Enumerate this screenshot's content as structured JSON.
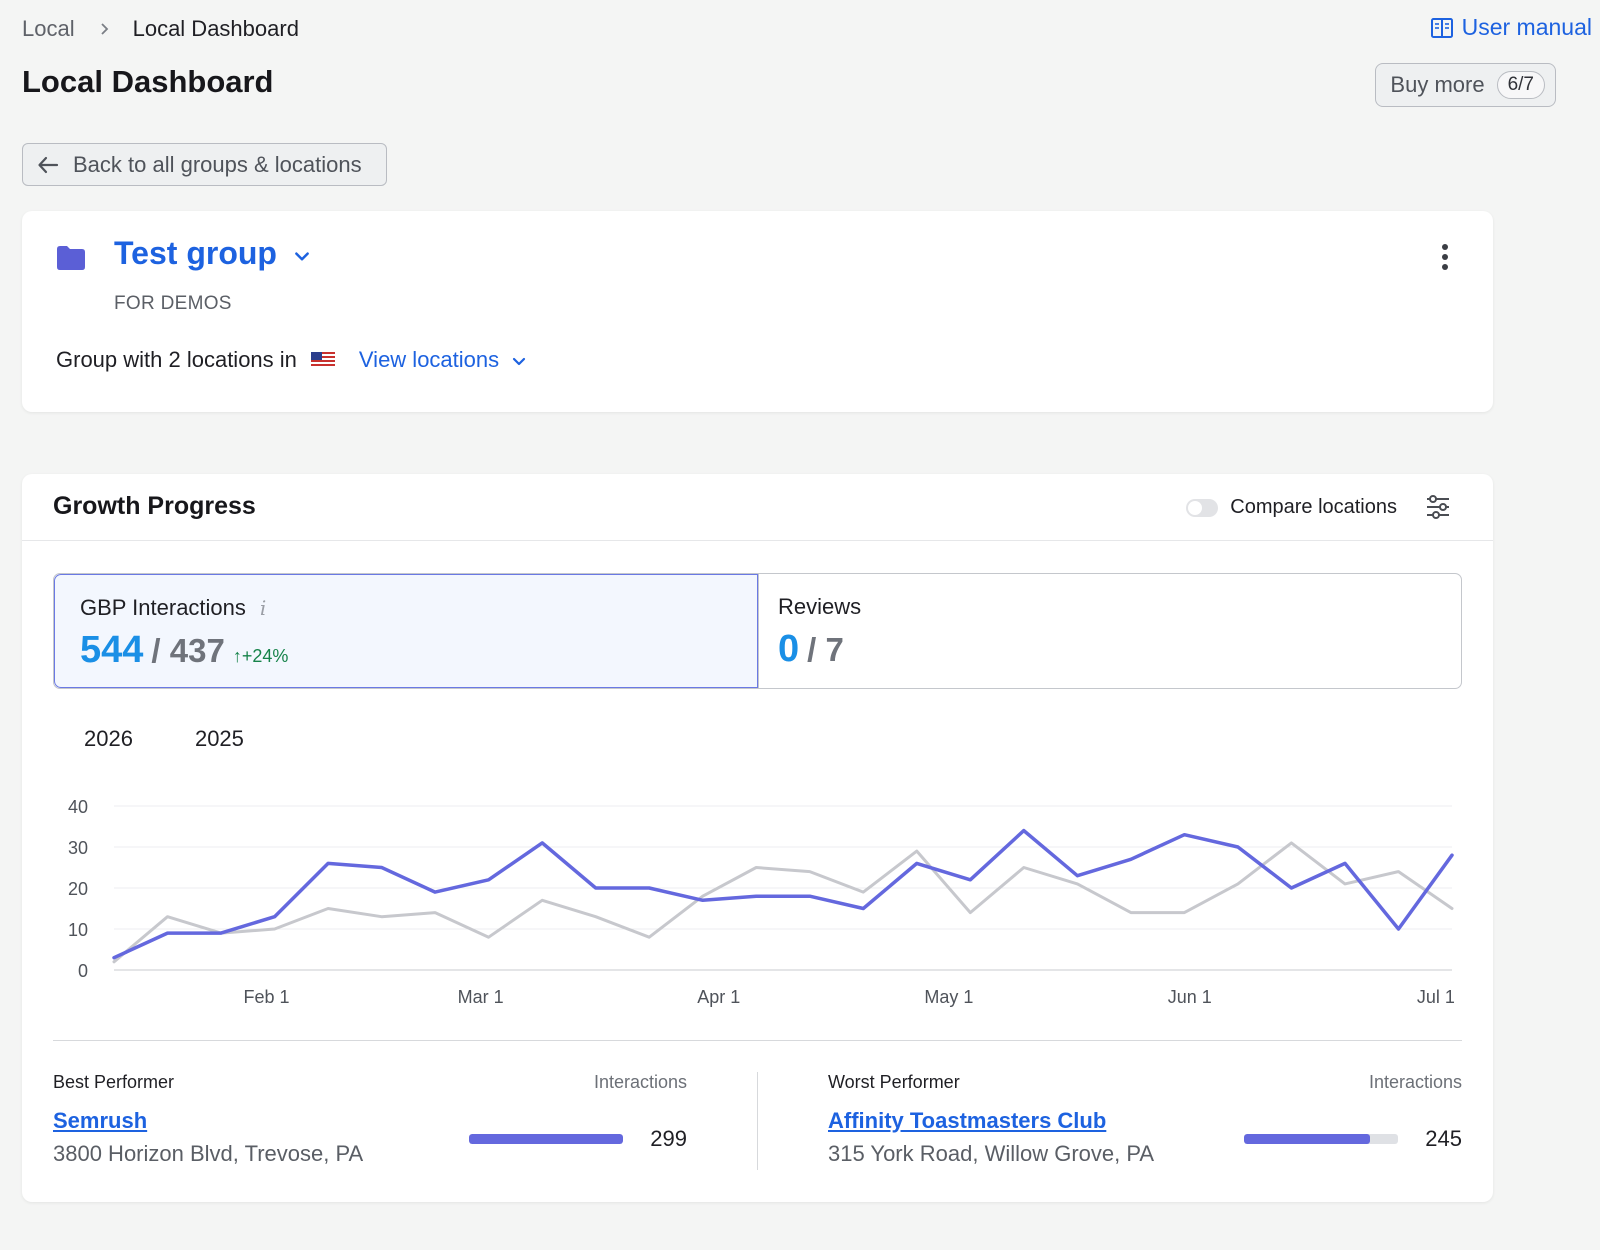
{
  "breadcrumb": {
    "parent": "Local",
    "current": "Local Dashboard"
  },
  "header": {
    "user_manual": "User manual",
    "title": "Local Dashboard",
    "buy_more": "Buy more",
    "buy_more_count": "6/7",
    "back": "Back to all groups & locations"
  },
  "group": {
    "name": "Test group",
    "subtitle": "FOR DEMOS",
    "description": "Group with 2 locations in",
    "view_locations": "View locations"
  },
  "growth": {
    "title": "Growth Progress",
    "compare_label": "Compare locations",
    "compare_on": false,
    "metrics": [
      {
        "label": "GBP Interactions",
        "current": "544",
        "previous": "/ 437",
        "delta": "↑+24%"
      },
      {
        "label": "Reviews",
        "current": "0",
        "previous": "/ 7"
      }
    ],
    "legend": [
      "2026",
      "2025"
    ]
  },
  "chart_data": {
    "type": "line",
    "y_ticks": [
      0,
      10,
      20,
      30,
      40
    ],
    "ylim": [
      0,
      40
    ],
    "x_tick_labels": [
      "Feb 1",
      "Mar 1",
      "Apr 1",
      "May 1",
      "Jun 1",
      "Jul 1"
    ],
    "x_tick_index": [
      2.85,
      6.85,
      11.3,
      15.6,
      20.1,
      24.7
    ],
    "points": 26,
    "series": [
      {
        "name": "2026",
        "color": "#6468de",
        "values": [
          3,
          9,
          9,
          13,
          26,
          25,
          19,
          22,
          31,
          20,
          20,
          17,
          18,
          18,
          15,
          26,
          22,
          34,
          23,
          27,
          33,
          30,
          20,
          26,
          10,
          28
        ]
      },
      {
        "name": "2025",
        "color": "#c7c8cd",
        "values": [
          2,
          13,
          9,
          10,
          15,
          13,
          14,
          8,
          17,
          13,
          8,
          18,
          25,
          24,
          19,
          29,
          14,
          25,
          21,
          14,
          14,
          21,
          31,
          21,
          24,
          15
        ]
      }
    ]
  },
  "performers": {
    "best": {
      "heading": "Best Performer",
      "col": "Interactions",
      "name": "Semrush",
      "address": "3800 Horizon Blvd, Trevose, PA",
      "value": "299",
      "fraction": 1.0
    },
    "worst": {
      "heading": "Worst Performer",
      "col": "Interactions",
      "name": "Affinity Toastmasters Club",
      "address": "315 York Road, Willow Grove, PA",
      "value": "245",
      "fraction": 0.82
    }
  },
  "colors": {
    "link": "#1d62e0",
    "accent": "#6468de",
    "metric_value": "#1a8fe6",
    "delta_positive": "#16834a"
  }
}
